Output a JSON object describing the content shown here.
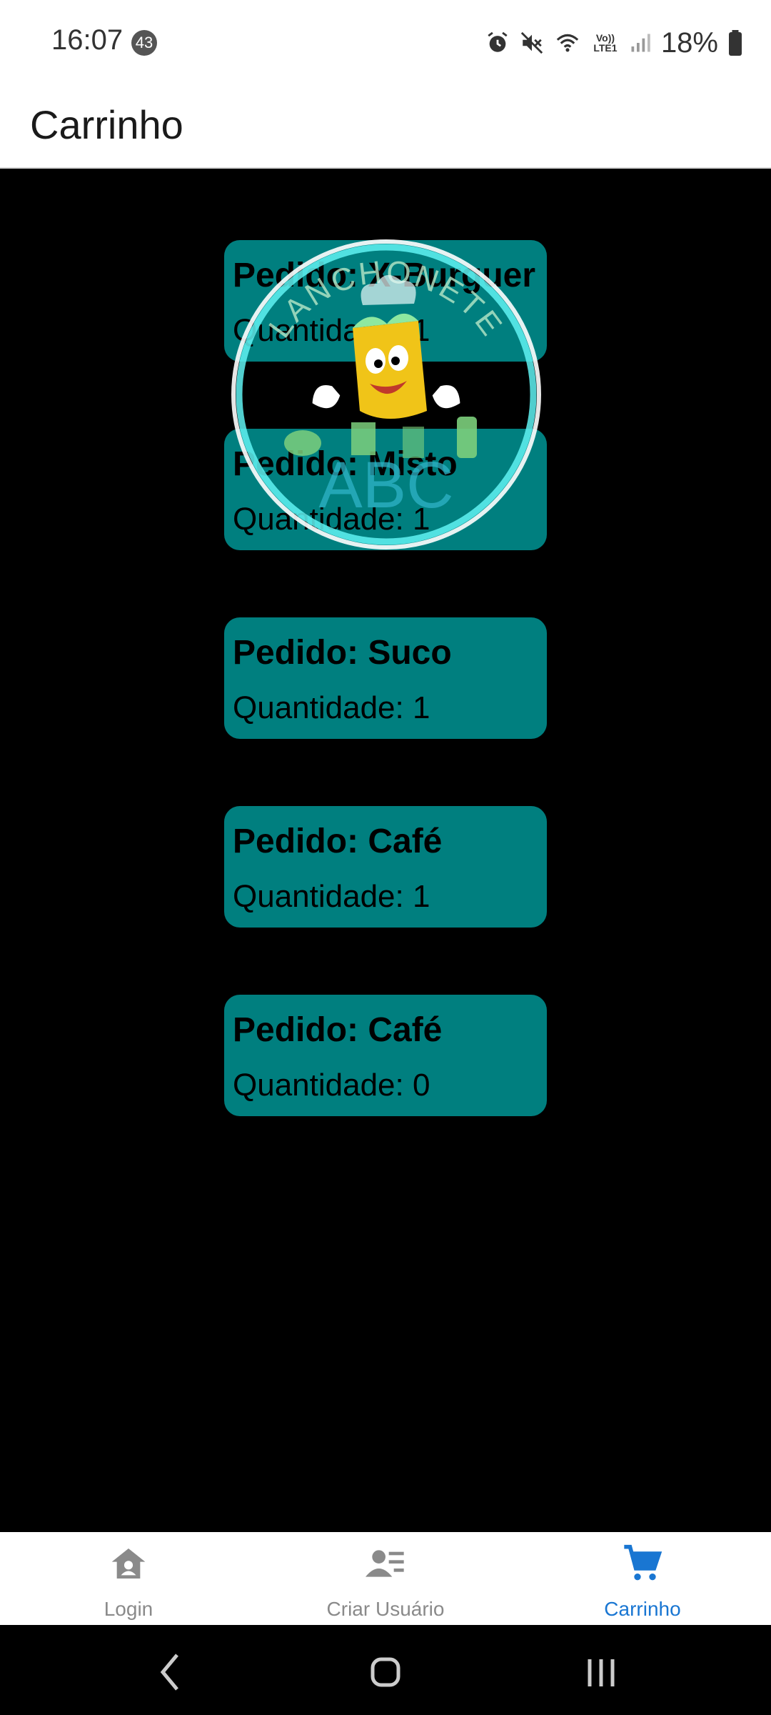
{
  "status": {
    "time": "16:07",
    "notification_count": "43",
    "network_label": "Vo)) LTE1",
    "battery": "18%"
  },
  "appbar": {
    "title": "Carrinho"
  },
  "orders": [
    {
      "title": "Pedido: X-Burguer",
      "quantity": "Quantidade: 1"
    },
    {
      "title": "Pedido: Misto",
      "quantity": "Quantidade: 1"
    },
    {
      "title": "Pedido: Suco",
      "quantity": "Quantidade: 1"
    },
    {
      "title": "Pedido: Café",
      "quantity": "Quantidade: 1"
    },
    {
      "title": "Pedido: Café",
      "quantity": "Quantidade: 0"
    }
  ],
  "logo": {
    "arc_text": "LANCHONETE",
    "brand": "ABC"
  },
  "tabs": [
    {
      "label": "Login",
      "icon": "home-icon",
      "active": false
    },
    {
      "label": "Criar Usuário",
      "icon": "user-list-icon",
      "active": false
    },
    {
      "label": "Carrinho",
      "icon": "cart-icon",
      "active": true
    }
  ],
  "colors": {
    "card": "#007f7f",
    "active_tab": "#1976d2",
    "inactive_tab": "#8a8a8a",
    "logo_ring": "#5ff2f2"
  },
  "nav": [
    "back-icon",
    "home-button-icon",
    "recents-icon"
  ]
}
